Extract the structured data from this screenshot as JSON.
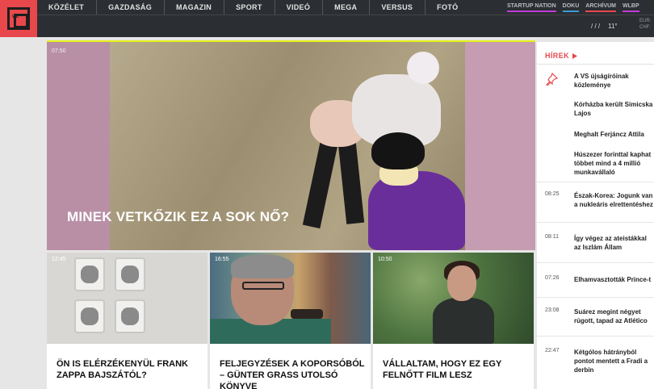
{
  "header": {
    "logo_text": "vs.",
    "nav": [
      "KÖZÉLET",
      "GAZDASÁG",
      "MAGAZIN",
      "SPORT",
      "VIDEÓ",
      "MEGA",
      "VERSUS",
      "FOTÓ"
    ],
    "subnav": [
      "STARTUP NATION",
      "DOKU",
      "ARCHÍVUM",
      "WLBP"
    ],
    "weather_icon_text": "/ / /",
    "temperature": "11°",
    "rates": [
      "EUR:",
      "CHF:"
    ]
  },
  "main_article": {
    "time": "07:50",
    "title": "MINEK VETKŐZIK EZ A SOK NŐ?"
  },
  "cards": [
    {
      "time": "12:45",
      "title": "ÖN IS ELÉRZÉKENYÜL FRANK ZAPPA BAJSZÁTÓL?"
    },
    {
      "time": "16:55",
      "title": "FELJEGYZÉSEK A KOPORSÓBÓL – GÜNTER GRASS UTOLSÓ KÖNYVE"
    },
    {
      "time": "10:50",
      "title": "VÁLLALTAM, HOGY EZ EGY FELNŐTT FILM LESZ"
    }
  ],
  "sidebar": {
    "heading": "HÍREK",
    "pinned": [
      "A VS újságíróinak közleménye",
      "Kórházba került Simicska Lajos",
      "Meghalt Ferjáncz Attila",
      "Húszezer forinttal kaphat többet mind a 4 millió munkavállaló"
    ],
    "items": [
      {
        "time": "08:25",
        "text": "Észak-Korea: Jogunk van a nukleáris elrettentéshez"
      },
      {
        "time": "08:11",
        "text": "Így végez az ateistákkal az Iszlám Állam"
      },
      {
        "time": "07:26",
        "text": "Elhamvasztották Prince-t"
      },
      {
        "time": "23:08",
        "text": "Suárez megint négyet rúgott, tapad az Atlético"
      },
      {
        "time": "22:47",
        "text": "Kétgólos hátrányból pontot mentett a Fradi a derbin"
      }
    ]
  }
}
